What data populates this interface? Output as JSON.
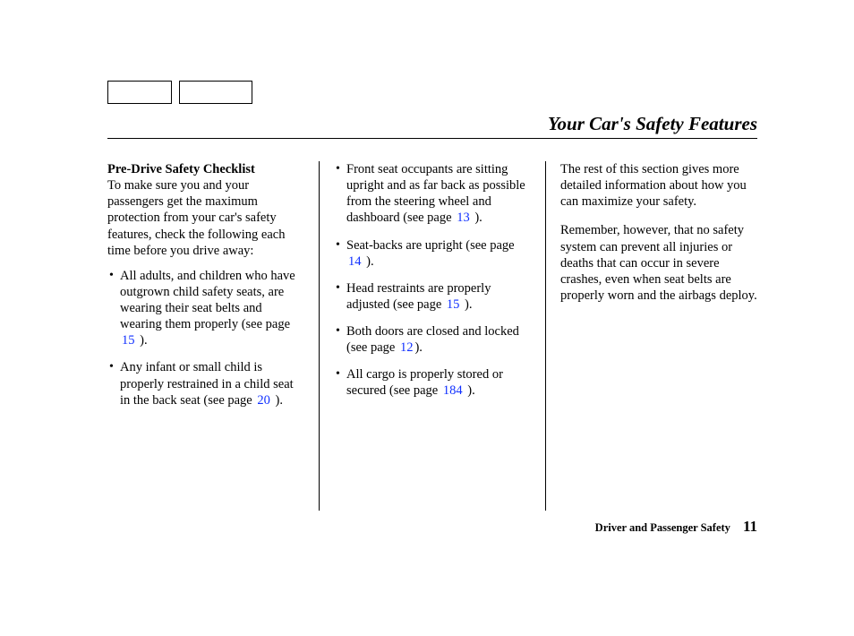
{
  "title": "Your Car's Safety Features",
  "col1": {
    "subhead": "Pre-Drive Safety Checklist",
    "intro": "To make sure you and your passengers get the maximum protection from your car's safety features, check the following each time before you drive away:",
    "items": [
      {
        "pre": "All adults, and children who have outgrown child safety seats, are wearing their seat belts and wearing them properly (see page ",
        "page": "15",
        "post": " )."
      },
      {
        "pre": "Any infant or small child is properly restrained in a child seat in the back seat (see page ",
        "page": "20",
        "post": " )."
      }
    ]
  },
  "col2": {
    "items": [
      {
        "pre": "Front seat occupants are sitting upright and as far back as possible from the steering wheel and dashboard (see page ",
        "page": "13",
        "post": " )."
      },
      {
        "pre": "Seat-backs are upright (see page ",
        "page": "14",
        "post": " )."
      },
      {
        "pre": "Head restraints are properly adjusted (see page ",
        "page": "15",
        "post": " )."
      },
      {
        "pre": "Both doors are closed and locked (see page ",
        "page": "12",
        "post": ")."
      },
      {
        "pre": "All cargo is properly stored or secured (see page ",
        "page": "184",
        "post": " )."
      }
    ]
  },
  "col3": {
    "p1": "The rest of this section gives more detailed information about how you can maximize your safety.",
    "p2": "Remember, however, that no safety system can prevent all injuries or deaths that can occur in severe crashes, even when seat belts are properly worn and the airbags deploy."
  },
  "footer": {
    "section": "Driver and Passenger Safety",
    "page": "11"
  }
}
